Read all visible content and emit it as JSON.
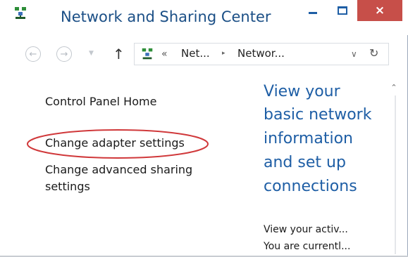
{
  "window": {
    "title": "Network and Sharing Center",
    "controls": {
      "minimize": "minimize",
      "maximize": "maximize",
      "close": "×"
    }
  },
  "nav": {
    "back_icon": "back-arrow-icon",
    "forward_icon": "forward-arrow-icon",
    "up_icon": "up-arrow-icon",
    "address": {
      "chevron": "«",
      "crumbs": [
        "Net...",
        "Networ..."
      ],
      "separator": "▸"
    },
    "refresh_icon": "refresh-icon"
  },
  "left_pane": {
    "home": "Control Panel Home",
    "adapter": "Change adapter settings",
    "advanced_line1": "Change advanced sharing",
    "advanced_line2": "settings"
  },
  "right_pane": {
    "heading_lines": [
      "View your",
      "basic network",
      "information",
      "and set up",
      "connections"
    ],
    "sub_lines": [
      "View your activ...",
      "You are currentl..."
    ]
  },
  "colors": {
    "title": "#1b4f86",
    "heading": "#1e5ea5",
    "close_button": "#c74f49",
    "highlight_ellipse": "#d0383a"
  }
}
